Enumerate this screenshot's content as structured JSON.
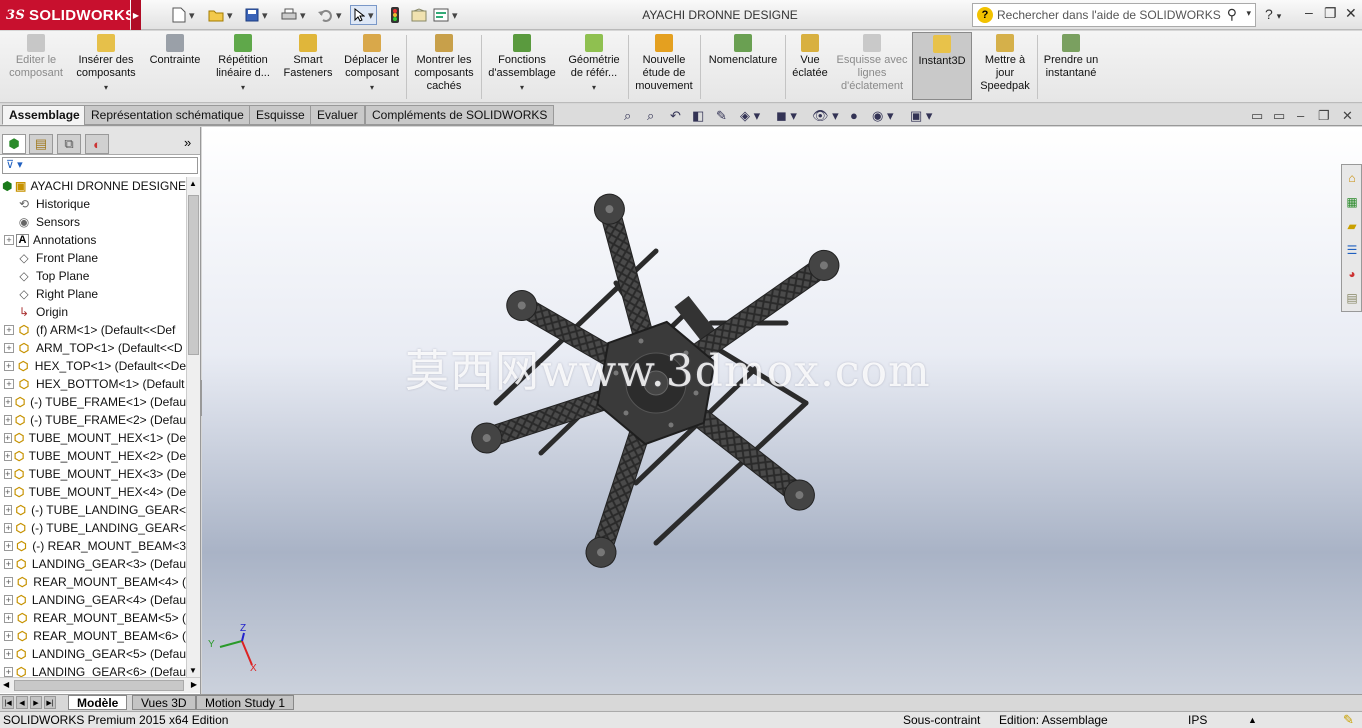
{
  "titlebar": {
    "logo_text": "SOLIDWORKS",
    "logo_mark": "3S",
    "document_title": "AYACHI DRONNE DESIGNE",
    "search_placeholder": "Rechercher dans l'aide de SOLIDWORKS",
    "help_label": "?",
    "brand_color": "#c8102e"
  },
  "ribbon": {
    "buttons": [
      {
        "label": "Editer le composant",
        "icon": "edit-component-icon",
        "disabled": true
      },
      {
        "label": "Insérer des composants",
        "icon": "insert-components-icon",
        "disabled": false
      },
      {
        "label": "Contrainte",
        "icon": "mate-icon",
        "disabled": false
      },
      {
        "label": "Répétition linéaire d...",
        "icon": "linear-pattern-icon",
        "disabled": false
      },
      {
        "label": "Smart Fasteners",
        "icon": "smart-fasteners-icon",
        "disabled": false
      },
      {
        "label": "Déplacer le composant",
        "icon": "move-component-icon",
        "disabled": false
      },
      {
        "label": "Montrer les composants cachés",
        "icon": "show-hidden-icon",
        "disabled": false
      },
      {
        "label": "Fonctions d'assemblage",
        "icon": "assembly-features-icon",
        "disabled": false
      },
      {
        "label": "Géométrie de référ...",
        "icon": "reference-geometry-icon",
        "disabled": false
      },
      {
        "label": "Nouvelle étude de mouvement",
        "icon": "motion-study-icon",
        "disabled": false
      },
      {
        "label": "Nomenclature",
        "icon": "bom-icon",
        "disabled": false
      },
      {
        "label": "Vue éclatée",
        "icon": "exploded-view-icon",
        "disabled": false
      },
      {
        "label": "Esquisse avec lignes d'éclatement",
        "icon": "explode-line-sketch-icon",
        "disabled": true
      },
      {
        "label": "Instant3D",
        "icon": "instant3d-icon",
        "disabled": false
      },
      {
        "label": "Mettre à jour Speedpak",
        "icon": "speedpak-icon",
        "disabled": false
      },
      {
        "label": "Prendre un instantané",
        "icon": "snapshot-icon",
        "disabled": false
      }
    ]
  },
  "command_tabs": [
    "Assemblage",
    "Représentation schématique",
    "Esquisse",
    "Evaluer",
    "Compléments de SOLIDWORKS"
  ],
  "feature_tree": {
    "root": "AYACHI DRONNE DESIGNE",
    "items": [
      {
        "label": "Historique",
        "kind": "history",
        "expandable": false
      },
      {
        "label": "Sensors",
        "kind": "sensor",
        "expandable": false
      },
      {
        "label": "Annotations",
        "kind": "annotation",
        "expandable": true
      },
      {
        "label": "Front Plane",
        "kind": "plane",
        "expandable": false
      },
      {
        "label": "Top Plane",
        "kind": "plane",
        "expandable": false
      },
      {
        "label": "Right Plane",
        "kind": "plane",
        "expandable": false
      },
      {
        "label": "Origin",
        "kind": "origin",
        "expandable": false
      },
      {
        "label": "(f) ARM<1> (Default<<Def",
        "kind": "part",
        "expandable": true
      },
      {
        "label": "ARM_TOP<1> (Default<<D",
        "kind": "part",
        "expandable": true
      },
      {
        "label": "HEX_TOP<1> (Default<<De",
        "kind": "part",
        "expandable": true
      },
      {
        "label": "HEX_BOTTOM<1> (Default",
        "kind": "part",
        "expandable": true
      },
      {
        "label": "(-) TUBE_FRAME<1> (Defau",
        "kind": "part",
        "expandable": true
      },
      {
        "label": "(-) TUBE_FRAME<2> (Defau",
        "kind": "part",
        "expandable": true
      },
      {
        "label": "TUBE_MOUNT_HEX<1> (De",
        "kind": "part",
        "expandable": true
      },
      {
        "label": "TUBE_MOUNT_HEX<2> (De",
        "kind": "part",
        "expandable": true
      },
      {
        "label": "TUBE_MOUNT_HEX<3> (De",
        "kind": "part",
        "expandable": true
      },
      {
        "label": "TUBE_MOUNT_HEX<4> (De",
        "kind": "part",
        "expandable": true
      },
      {
        "label": "(-) TUBE_LANDING_GEAR<",
        "kind": "part",
        "expandable": true
      },
      {
        "label": "(-) TUBE_LANDING_GEAR<",
        "kind": "part",
        "expandable": true
      },
      {
        "label": "(-) REAR_MOUNT_BEAM<3",
        "kind": "part",
        "expandable": true
      },
      {
        "label": "LANDING_GEAR<3> (Defau",
        "kind": "part",
        "expandable": true
      },
      {
        "label": "REAR_MOUNT_BEAM<4> (",
        "kind": "part",
        "expandable": true
      },
      {
        "label": "LANDING_GEAR<4> (Defau",
        "kind": "part",
        "expandable": true
      },
      {
        "label": "REAR_MOUNT_BEAM<5> (",
        "kind": "part",
        "expandable": true
      },
      {
        "label": "REAR_MOUNT_BEAM<6> (",
        "kind": "part",
        "expandable": true
      },
      {
        "label": "LANDING_GEAR<5> (Defau",
        "kind": "part",
        "expandable": true
      },
      {
        "label": "LANDING_GEAR<6> (Defau",
        "kind": "part",
        "expandable": true
      }
    ]
  },
  "viewport": {
    "watermark": "莫西网www.3dmox.com",
    "triad": {
      "x": "X",
      "y": "Y",
      "z": "Z"
    }
  },
  "bottom_tabs": [
    "Modèle",
    "Vues 3D",
    "Motion Study 1"
  ],
  "status": {
    "product": "SOLIDWORKS Premium 2015 x64 Edition",
    "constraint": "Sous-contraint",
    "mode": "Edition: Assemblage",
    "units": "IPS"
  }
}
